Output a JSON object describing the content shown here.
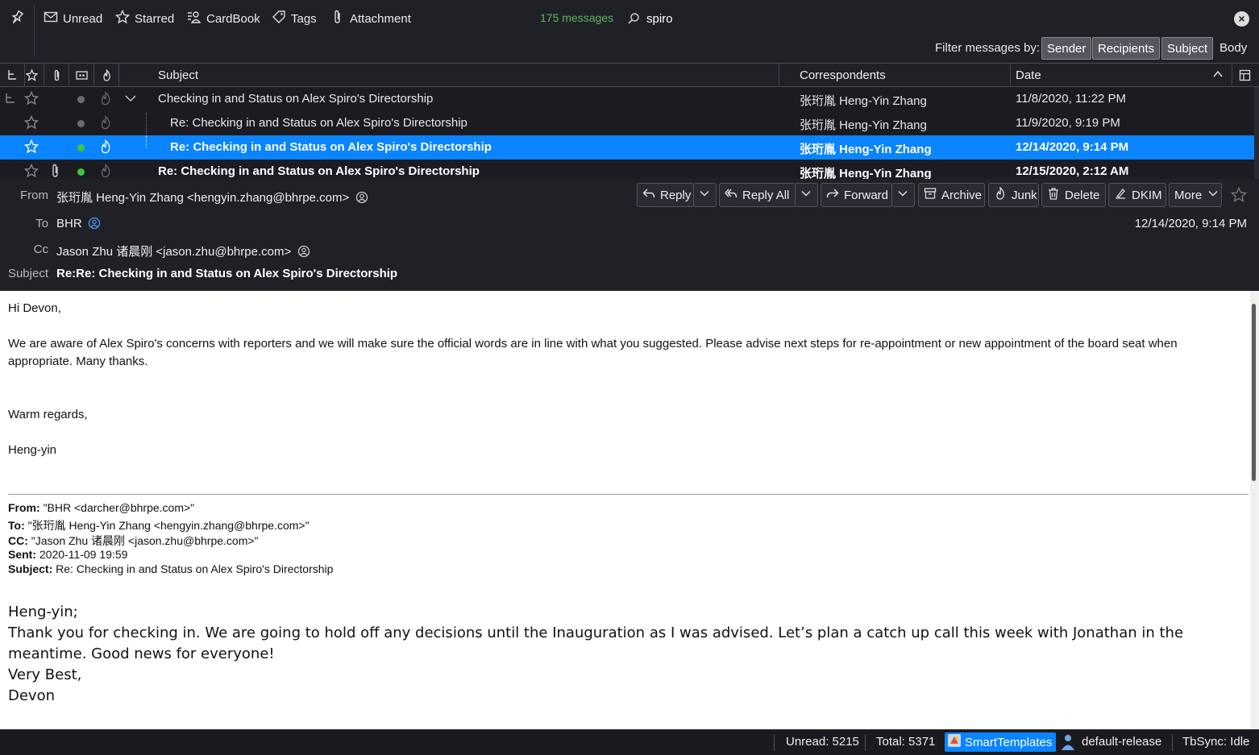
{
  "quick_filter": {
    "unread": "Unread",
    "starred": "Starred",
    "cardbook": "CardBook",
    "tags": "Tags",
    "attachment": "Attachment",
    "message_count": "175 messages",
    "search_value": "spiro",
    "filter_label": "Filter messages by:",
    "filters": {
      "sender": "Sender",
      "recipients": "Recipients",
      "subject": "Subject",
      "body": "Body"
    }
  },
  "columns": {
    "subject": "Subject",
    "correspondents": "Correspondents",
    "date": "Date"
  },
  "threads": [
    {
      "subject": "Checking in and Status on Alex Spiro's Directorship",
      "correspondent": "张珩胤 Heng-Yin Zhang",
      "date": "11/8/2020, 11:22 PM"
    },
    {
      "subject": "Re: Checking in and Status on Alex Spiro's Directorship",
      "correspondent": "张珩胤 Heng-Yin Zhang",
      "date": "11/9/2020, 9:19 PM"
    },
    {
      "subject": "Re: Checking in and Status on Alex Spiro's Directorship",
      "correspondent": "张珩胤 Heng-Yin Zhang",
      "date": "12/14/2020, 9:14 PM"
    },
    {
      "subject": "Re: Checking in and Status on Alex Spiro's Directorship",
      "correspondent": "张珩胤 Heng-Yin Zhang",
      "date": "12/15/2020, 2:12 AM"
    }
  ],
  "header": {
    "from_label": "From",
    "from_value": "张珩胤 Heng-Yin Zhang <hengyin.zhang@bhrpe.com>",
    "to_label": "To",
    "to_value": "BHR",
    "cc_label": "Cc",
    "cc_value": "Jason Zhu 诸晨刚 <jason.zhu@bhrpe.com>",
    "subject_label": "Subject",
    "subject_value": "Re:Re: Checking in and Status on Alex Spiro's Directorship",
    "date": "12/14/2020, 9:14 PM",
    "buttons": {
      "reply": "Reply",
      "reply_all": "Reply All",
      "forward": "Forward",
      "archive": "Archive",
      "junk": "Junk",
      "delete": "Delete",
      "dkim": "DKIM",
      "more": "More"
    }
  },
  "body": {
    "greeting": "Hi Devon,",
    "para1": "We are aware of Alex Spiro's concerns with reporters and we will make sure the official words are in line with what you suggested. Please advise next steps for re-appointment or new appointment of the board seat when appropriate. Many thanks.",
    "regards": "Warm regards,",
    "signature": "Heng-yin",
    "quoted_header": {
      "from_label": "From:",
      "from_value": "\"BHR <darcher@bhrpe.com>\"",
      "to_label": "To:",
      "to_value": "\"张珩胤 Heng-Yin Zhang <hengyin.zhang@bhrpe.com>\"",
      "cc_label": "CC:",
      "cc_value": "\"Jason Zhu 诸晨刚 <jason.zhu@bhrpe.com>\"",
      "sent_label": "Sent:",
      "sent_value": "2020-11-09 19:59",
      "subject_label": "Subject:",
      "subject_value": "Re: Checking in and Status on Alex Spiro's Directorship"
    },
    "quoted_line1": "Heng-yin;",
    "quoted_line2": "Thank you for checking in.  We are going to hold off any decisions until the Inauguration as I was advised. Let’s plan a catch up call this week with Jonathan in the meantime.  Good news for everyone!",
    "quoted_line3": "Very Best,",
    "quoted_line4": "Devon"
  },
  "status": {
    "unread": "Unread: 5215",
    "total": "Total: 5371",
    "smart_templates": "SmartTemplates",
    "release": "default-release",
    "tbsync": "TbSync: Idle"
  },
  "colors": {
    "accent": "#0a84ff",
    "unread_dot": "#3fc43f",
    "msg_count": "#5bb55b"
  }
}
